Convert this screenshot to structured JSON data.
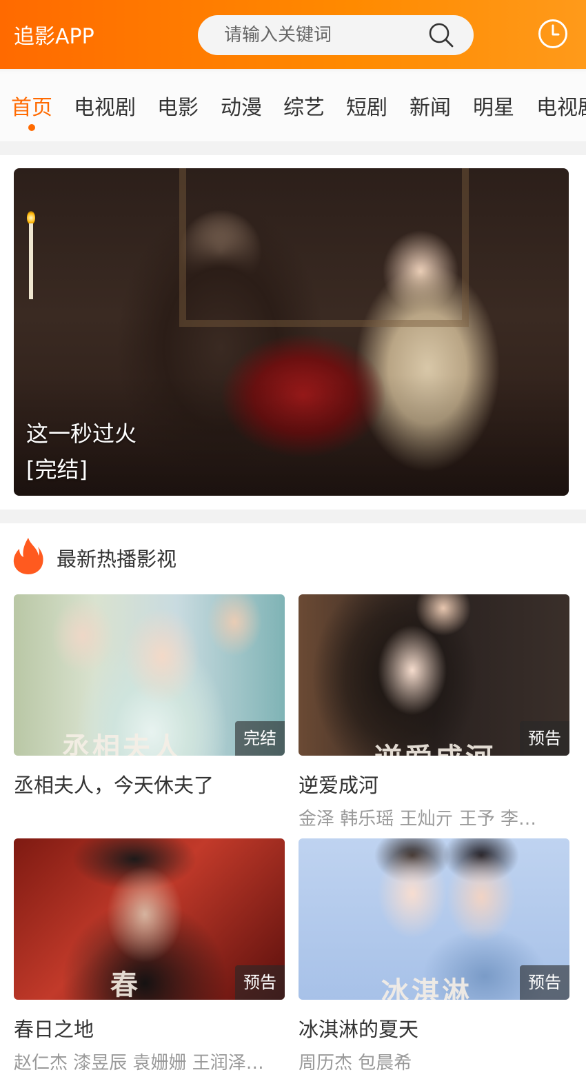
{
  "header": {
    "logo": "追影APP",
    "search_placeholder": "请输入关键词"
  },
  "nav": {
    "items": [
      {
        "label": "首页",
        "active": true
      },
      {
        "label": "电视剧",
        "active": false
      },
      {
        "label": "电影",
        "active": false
      },
      {
        "label": "动漫",
        "active": false
      },
      {
        "label": "综艺",
        "active": false
      },
      {
        "label": "短剧",
        "active": false
      },
      {
        "label": "新闻",
        "active": false
      },
      {
        "label": "明星",
        "active": false
      },
      {
        "label": "电视剧",
        "active": false
      }
    ]
  },
  "banner": {
    "title": "这一秒过火",
    "status": "[完结]"
  },
  "section": {
    "title": "最新热播影视",
    "icon": "fire-icon"
  },
  "cards": [
    {
      "title": "丞相夫人，今天休夫了",
      "cast": "",
      "badge": "完结",
      "poster_text": "丞相夫人"
    },
    {
      "title": "逆爱成河",
      "cast": "金泽 韩乐瑶 王灿亓 王予 李…",
      "badge": "预告",
      "poster_text": "逆爱成河"
    },
    {
      "title": "春日之地",
      "cast": "赵仁杰 漆昱辰 袁姗姗 王润泽…",
      "badge": "预告",
      "poster_text": "春"
    },
    {
      "title": "冰淇淋的夏天",
      "cast": "周历杰 包晨希",
      "badge": "预告",
      "poster_text": "冰淇淋"
    }
  ],
  "colors": {
    "accent": "#ff6a00",
    "badge_bg": "rgba(40,40,40,0.6)"
  }
}
